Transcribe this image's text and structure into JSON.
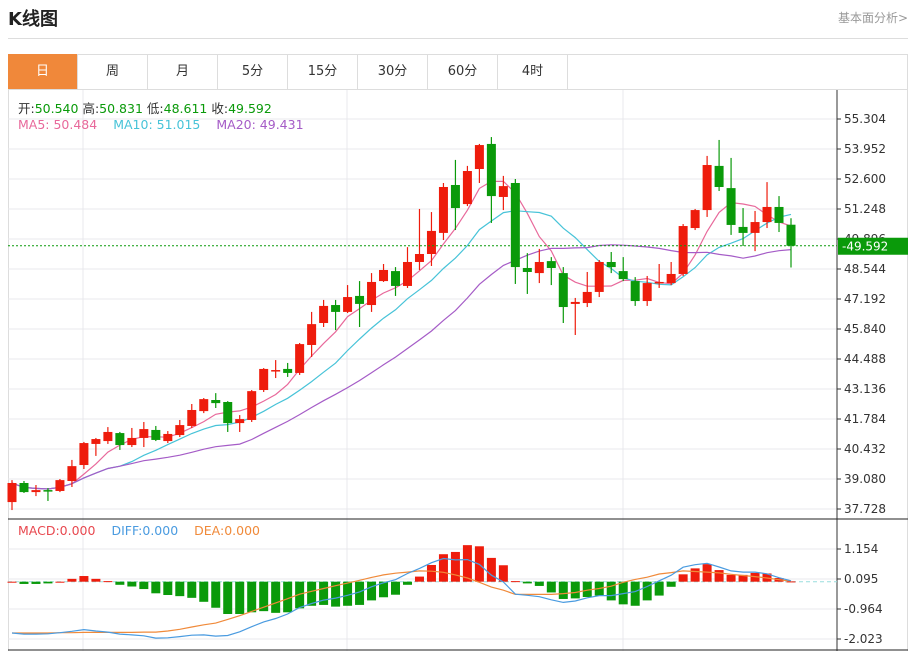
{
  "header": {
    "title": "K线图",
    "link": "基本面分析>"
  },
  "tabs": [
    {
      "label": "日",
      "active": true
    },
    {
      "label": "周"
    },
    {
      "label": "月"
    },
    {
      "label": "5分"
    },
    {
      "label": "15分"
    },
    {
      "label": "30分"
    },
    {
      "label": "60分"
    },
    {
      "label": "4时"
    }
  ],
  "ohlc_legend": {
    "open_label": "开:",
    "open": "50.540",
    "high_label": "高:",
    "high": "50.831",
    "low_label": "低:",
    "low": "48.611",
    "close_label": "收:",
    "close": "49.592"
  },
  "ma_legend": {
    "ma5": "MA5: 50.484",
    "ma10": "MA10: 51.015",
    "ma20": "MA20: 49.431"
  },
  "macd_legend": {
    "macd": "MACD:0.000",
    "diff": "DIFF:0.000",
    "dea": "DEA:0.000"
  },
  "colors": {
    "up": "#ee1c0c",
    "down": "#0a9a0a",
    "ma5": "#e8699b",
    "ma10": "#47c3d8",
    "ma20": "#a55cc7",
    "macd": "#e8484f",
    "diff": "#4a9be0",
    "dea": "#f08a3a",
    "active_tab": "#f0883a"
  },
  "chart_data": [
    {
      "type": "candlestick",
      "title": "",
      "yticks": [
        "55.304",
        "53.952",
        "52.600",
        "51.248",
        "49.896",
        "48.544",
        "47.192",
        "45.840",
        "44.488",
        "43.136",
        "41.784",
        "40.432",
        "39.080",
        "37.728"
      ],
      "ylim": [
        37.728,
        55.304
      ],
      "grid": true,
      "last_price": "49.592",
      "ma_periods": [
        5,
        10,
        20
      ],
      "candles": [
        [
          38.04,
          39.03,
          37.68,
          38.9
        ],
        [
          38.9,
          38.99,
          38.45,
          38.49
        ],
        [
          38.49,
          38.81,
          38.31,
          38.58
        ],
        [
          38.58,
          38.67,
          38.09,
          38.54
        ],
        [
          38.54,
          39.08,
          38.49,
          39.03
        ],
        [
          38.99,
          39.94,
          38.72,
          39.66
        ],
        [
          39.71,
          40.75,
          39.53,
          40.7
        ],
        [
          40.66,
          40.93,
          40.12,
          40.88
        ],
        [
          40.79,
          41.42,
          40.66,
          41.2
        ],
        [
          41.15,
          41.2,
          40.39,
          40.61
        ],
        [
          40.61,
          41.38,
          40.52,
          40.93
        ],
        [
          40.93,
          41.65,
          40.52,
          41.33
        ],
        [
          41.29,
          41.47,
          40.79,
          40.84
        ],
        [
          40.79,
          41.24,
          40.7,
          41.11
        ],
        [
          41.06,
          41.74,
          40.97,
          41.51
        ],
        [
          41.47,
          42.46,
          41.38,
          42.19
        ],
        [
          42.14,
          42.73,
          42.05,
          42.68
        ],
        [
          42.64,
          42.95,
          42.28,
          42.5
        ],
        [
          42.55,
          42.59,
          41.2,
          41.6
        ],
        [
          41.6,
          41.96,
          41.2,
          41.78
        ],
        [
          41.74,
          43.09,
          41.65,
          43.04
        ],
        [
          43.09,
          44.08,
          43.0,
          44.04
        ],
        [
          43.95,
          44.44,
          43.63,
          43.99
        ],
        [
          44.04,
          44.31,
          43.68,
          43.86
        ],
        [
          43.86,
          45.21,
          43.77,
          45.16
        ],
        [
          45.12,
          46.61,
          44.58,
          46.06
        ],
        [
          46.11,
          47.15,
          45.93,
          46.88
        ],
        [
          46.92,
          47.15,
          45.79,
          46.61
        ],
        [
          46.61,
          47.82,
          46.56,
          47.28
        ],
        [
          47.33,
          48.0,
          45.93,
          46.97
        ],
        [
          46.92,
          48.36,
          46.61,
          47.96
        ],
        [
          48.0,
          48.77,
          47.96,
          48.5
        ],
        [
          48.45,
          48.63,
          47.33,
          47.78
        ],
        [
          47.78,
          49.53,
          47.69,
          48.86
        ],
        [
          48.86,
          51.25,
          48.5,
          49.22
        ],
        [
          49.22,
          51.11,
          48.68,
          50.26
        ],
        [
          50.17,
          52.42,
          49.85,
          52.24
        ],
        [
          52.33,
          53.46,
          50.3,
          51.29
        ],
        [
          51.47,
          53.19,
          51.38,
          52.96
        ],
        [
          53.05,
          54.18,
          52.42,
          54.13
        ],
        [
          54.18,
          54.49,
          50.62,
          51.83
        ],
        [
          51.79,
          52.74,
          51.2,
          52.28
        ],
        [
          52.42,
          52.6,
          47.87,
          48.63
        ],
        [
          48.59,
          49.26,
          47.42,
          48.41
        ],
        [
          48.36,
          49.45,
          47.91,
          48.86
        ],
        [
          48.9,
          49.08,
          47.82,
          48.59
        ],
        [
          48.36,
          48.63,
          46.11,
          46.83
        ],
        [
          46.97,
          47.24,
          45.57,
          47.06
        ],
        [
          47.01,
          48.41,
          46.83,
          47.51
        ],
        [
          47.51,
          48.95,
          47.28,
          48.86
        ],
        [
          48.86,
          49.31,
          48.36,
          48.63
        ],
        [
          48.45,
          49.08,
          48.0,
          48.09
        ],
        [
          48.0,
          48.18,
          46.88,
          47.1
        ],
        [
          47.1,
          48.23,
          46.88,
          47.91
        ],
        [
          47.91,
          48.77,
          47.69,
          47.96
        ],
        [
          47.91,
          48.86,
          47.82,
          48.32
        ],
        [
          48.32,
          50.57,
          48.23,
          50.48
        ],
        [
          50.39,
          51.25,
          50.3,
          51.2
        ],
        [
          51.2,
          53.64,
          50.89,
          53.23
        ],
        [
          53.19,
          54.36,
          52.06,
          52.24
        ],
        [
          52.19,
          53.55,
          50.08,
          50.53
        ],
        [
          50.44,
          51.29,
          49.58,
          50.17
        ],
        [
          50.17,
          51.16,
          49.35,
          50.66
        ],
        [
          50.66,
          52.46,
          50.39,
          51.34
        ],
        [
          51.34,
          51.83,
          50.21,
          50.62
        ],
        [
          50.54,
          50.831,
          48.611,
          49.592
        ]
      ]
    },
    {
      "type": "bar+line",
      "title": "",
      "yticks": [
        "1.154",
        "0.095",
        "-0.964",
        "-2.023"
      ],
      "ylim": [
        -2.023,
        1.154
      ],
      "grid": true,
      "macd": [
        0.0,
        -0.08,
        -0.08,
        -0.06,
        0.0,
        0.1,
        0.2,
        0.1,
        0.02,
        -0.11,
        -0.17,
        -0.26,
        -0.41,
        -0.47,
        -0.51,
        -0.57,
        -0.71,
        -0.92,
        -1.14,
        -1.14,
        -1.08,
        -1.04,
        -1.1,
        -1.08,
        -0.94,
        -0.85,
        -0.82,
        -0.88,
        -0.85,
        -0.82,
        -0.66,
        -0.55,
        -0.46,
        -0.11,
        0.18,
        0.59,
        0.97,
        1.05,
        1.29,
        1.25,
        0.84,
        0.58,
        0.02,
        -0.06,
        -0.15,
        -0.38,
        -0.61,
        -0.59,
        -0.54,
        -0.49,
        -0.66,
        -0.8,
        -0.85,
        -0.66,
        -0.49,
        -0.18,
        0.26,
        0.47,
        0.62,
        0.41,
        0.24,
        0.24,
        0.31,
        0.29,
        0.13,
        0.01
      ],
      "dea": [
        -1.81,
        -1.81,
        -1.81,
        -1.81,
        -1.8,
        -1.8,
        -1.79,
        -1.79,
        -1.79,
        -1.79,
        -1.79,
        -1.78,
        -1.78,
        -1.74,
        -1.68,
        -1.6,
        -1.52,
        -1.46,
        -1.33,
        -1.2,
        -1.05,
        -0.9,
        -0.75,
        -0.6,
        -0.44,
        -0.34,
        -0.24,
        -0.14,
        -0.05,
        0.05,
        0.15,
        0.24,
        0.3,
        0.34,
        0.38,
        0.37,
        0.33,
        0.24,
        0.13,
        -0.02,
        -0.19,
        -0.3,
        -0.45,
        -0.45,
        -0.45,
        -0.45,
        -0.42,
        -0.38,
        -0.3,
        -0.24,
        -0.16,
        -0.02,
        0.08,
        0.16,
        0.27,
        0.32,
        0.38,
        0.36,
        0.34,
        0.31,
        0.26,
        0.22,
        0.18,
        0.13,
        0.07,
        0.02
      ],
      "diff": [
        -1.81,
        -1.85,
        -1.85,
        -1.84,
        -1.8,
        -1.75,
        -1.69,
        -1.74,
        -1.78,
        -1.85,
        -1.88,
        -1.91,
        -1.99,
        -1.98,
        -1.94,
        -1.89,
        -1.88,
        -1.92,
        -1.9,
        -1.77,
        -1.59,
        -1.42,
        -1.3,
        -1.14,
        -0.91,
        -0.77,
        -0.65,
        -0.58,
        -0.48,
        -0.36,
        -0.18,
        -0.04,
        0.07,
        0.29,
        0.47,
        0.67,
        0.82,
        0.77,
        0.78,
        0.61,
        0.23,
        -0.01,
        -0.44,
        -0.48,
        -0.53,
        -0.64,
        -0.73,
        -0.68,
        -0.57,
        -0.49,
        -0.49,
        -0.42,
        -0.35,
        -0.17,
        0.03,
        0.23,
        0.51,
        0.6,
        0.65,
        0.52,
        0.38,
        0.34,
        0.34,
        0.28,
        0.14,
        0.03
      ]
    }
  ]
}
